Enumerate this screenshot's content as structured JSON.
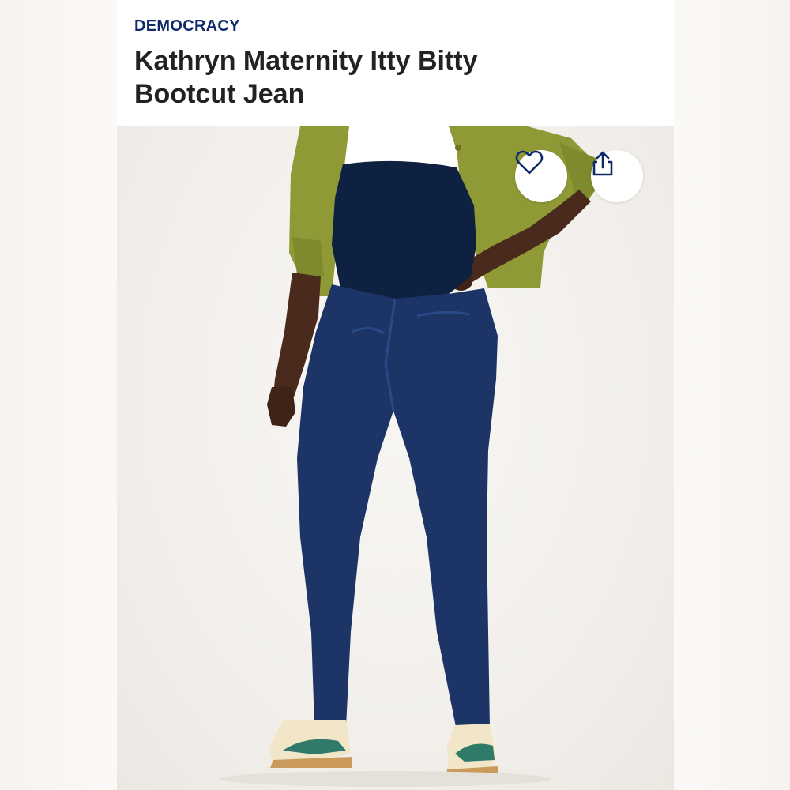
{
  "product": {
    "brand": "DEMOCRACY",
    "title": "Kathryn Maternity Itty Bitty Bootcut Jean"
  },
  "actions": {
    "favorite_icon": "heart-icon",
    "share_icon": "share-icon"
  },
  "colors": {
    "brand": "#0f2a6b",
    "title": "#222222",
    "icon_stroke": "#0f2a6b"
  },
  "image": {
    "subject": "product-photo"
  }
}
